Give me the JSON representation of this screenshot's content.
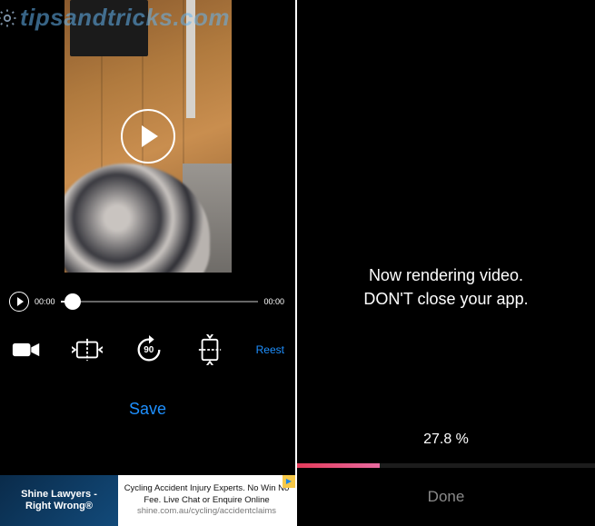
{
  "watermark": "tipsandtricks.com",
  "left": {
    "time_start": "00:00",
    "time_end": "00:00",
    "rotate_90_label": "90",
    "reset_label": "Reest",
    "save_label": "Save",
    "ad": {
      "title_line1": "Shine Lawyers -",
      "title_line2": "Right Wrong®",
      "body_line1": "Cycling Accident Injury Experts. No Win No",
      "body_line2": "Fee. Live Chat or Enquire Online",
      "body_line3": "shine.com.au/cycling/accidentclaims",
      "badge": "▶"
    }
  },
  "right": {
    "msg_line1": "Now rendering video.",
    "msg_line2": "DON'T close your app.",
    "progress_text": "27.8 %",
    "progress_value": 27.8,
    "done_label": "Done"
  }
}
